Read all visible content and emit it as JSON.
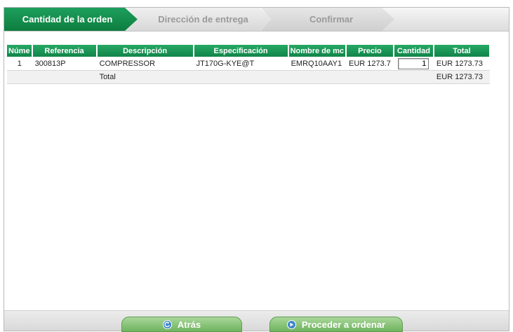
{
  "steps": [
    {
      "label": "Cantidad de la orden",
      "active": true
    },
    {
      "label": "Dirección de entrega",
      "active": false
    },
    {
      "label": "Confirmar",
      "active": false
    }
  ],
  "table": {
    "headers": [
      "Núme",
      "Referencia",
      "Descripción",
      "Especificación",
      "Nombre de mc",
      "Precio",
      "Cantidad",
      "Total"
    ],
    "rows": [
      {
        "num": "1",
        "reference": "300813P",
        "description": "COMPRESSOR",
        "specification": "JT170G-KYE@T",
        "model": "EMRQ10AAY1",
        "price": "EUR 1273.7",
        "quantity": "1",
        "total": "EUR 1273.73"
      }
    ],
    "total_label": "Total",
    "total_value": "EUR 1273.73"
  },
  "buttons": {
    "back_label": "Atrás",
    "next_label": "Proceder a ordenar"
  },
  "colors": {
    "accent": "#0d7d3f",
    "header": "#1a9a55",
    "button": "#7fbf6f",
    "icon": "#3f86c8"
  }
}
